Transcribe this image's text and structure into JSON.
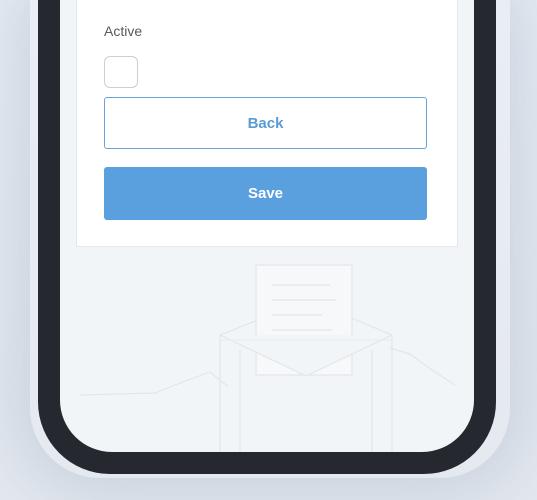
{
  "form": {
    "active_label": "Active",
    "active_checked": false,
    "back_label": "Back",
    "save_label": "Save"
  },
  "colors": {
    "primary": "#5aa0de",
    "primary_text": "#5b9bd3",
    "phone_frame": "#25282e",
    "screen_bg": "#f2f5f8"
  },
  "icons": [
    "envelope-illustration"
  ]
}
